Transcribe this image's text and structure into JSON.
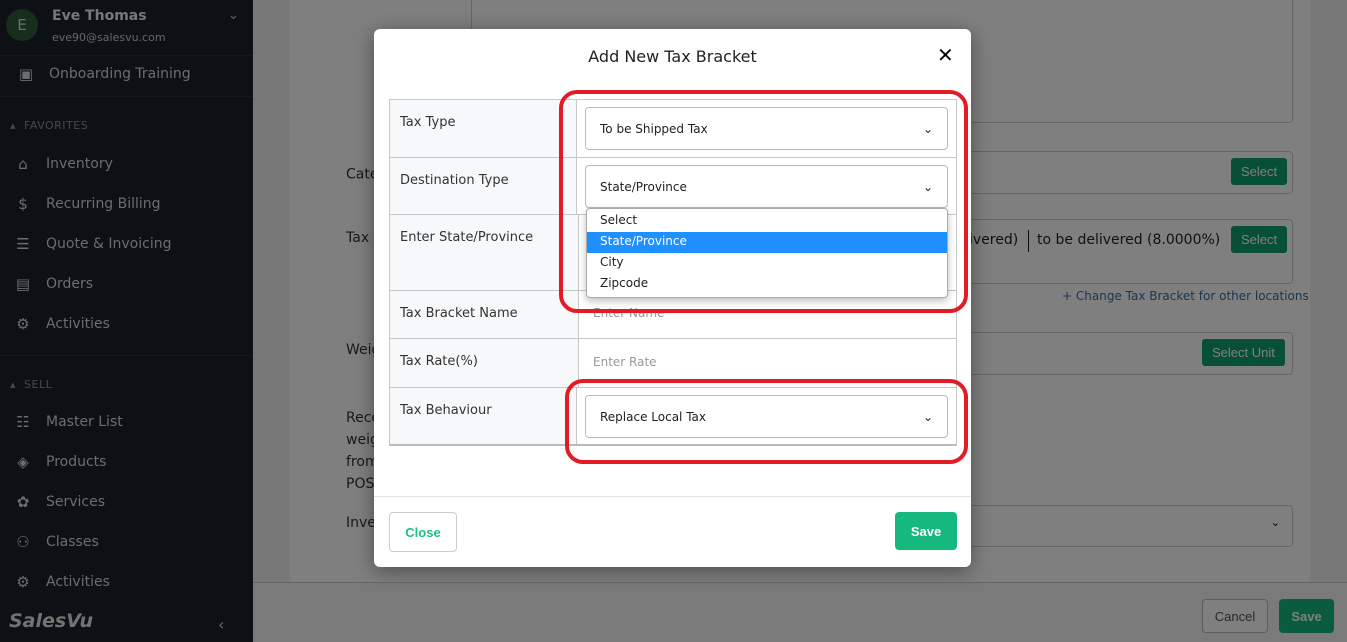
{
  "sidebar": {
    "user": {
      "initial": "E",
      "name": "Eve Thomas",
      "email": "eve90@salesvu.com"
    },
    "onboarding": "Onboarding Training",
    "favorites_title": "FAVORITES",
    "favorites": [
      {
        "label": "Inventory",
        "icon": "inventory-icon"
      },
      {
        "label": "Recurring Billing",
        "icon": "dollar-icon"
      },
      {
        "label": "Quote & Invoicing",
        "icon": "invoice-icon"
      },
      {
        "label": "Orders",
        "icon": "orders-icon"
      },
      {
        "label": "Activities",
        "icon": "activities-icon"
      }
    ],
    "sell_title": "SELL",
    "sell": [
      {
        "label": "Master List",
        "icon": "list-icon"
      },
      {
        "label": "Products",
        "icon": "box-icon"
      },
      {
        "label": "Services",
        "icon": "services-icon"
      },
      {
        "label": "Classes",
        "icon": "classes-icon"
      },
      {
        "label": "Activities",
        "icon": "activities-icon"
      }
    ],
    "logo": "SalesVu"
  },
  "background_form": {
    "category_label": "Category",
    "tax_bracket_label": "Tax Bracket",
    "weight_label": "Weight",
    "receive_label": "Receive weight from scale POS",
    "inventory_label": "Inventory S",
    "select": "Select",
    "select_unit": "Select Unit",
    "tax_bracket_value_partial": "ivered)",
    "tax_bracket_value": "to be delivered (8.0000%)",
    "change_link": "+ Change Tax Bracket for other locations",
    "cancel": "Cancel",
    "save": "Save"
  },
  "modal": {
    "title": "Add New Tax Bracket",
    "rows": {
      "tax_type": {
        "label": "Tax Type",
        "value": "To be Shipped Tax"
      },
      "destination_type": {
        "label": "Destination Type",
        "value": "State/Province",
        "options": [
          "Select",
          "State/Province",
          "City",
          "Zipcode"
        ],
        "selected": "State/Province"
      },
      "state": {
        "label": "Enter State/Province"
      },
      "name": {
        "label": "Tax Bracket Name",
        "placeholder": "Enter Name"
      },
      "rate": {
        "label": "Tax Rate(%)",
        "placeholder": "Enter Rate"
      },
      "behaviour": {
        "label": "Tax Behaviour",
        "value": "Replace Local Tax"
      }
    },
    "close": "Close",
    "save": "Save"
  },
  "colors": {
    "accent": "#16b97d",
    "highlight": "#e11c24",
    "selected_option": "#1e90ff"
  }
}
